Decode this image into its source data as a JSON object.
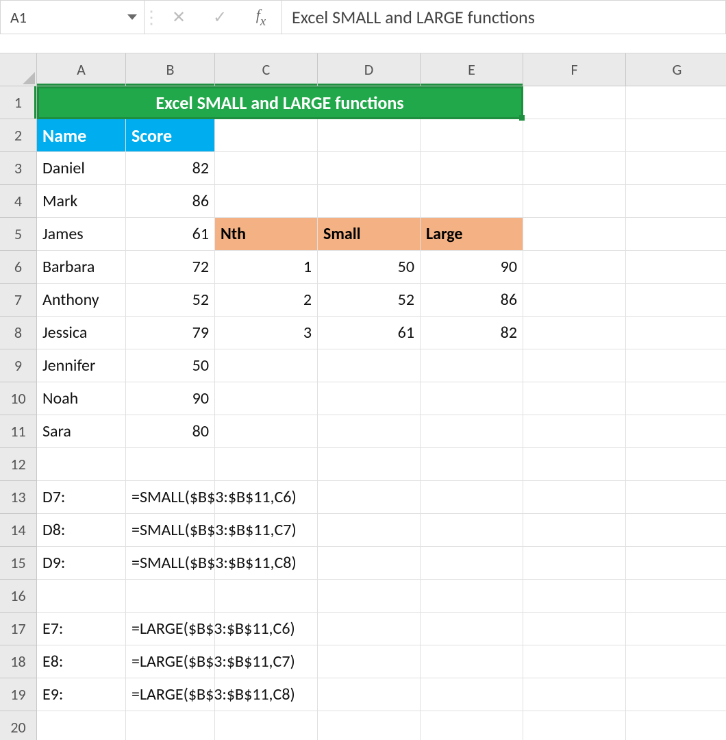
{
  "toolbar": {
    "name_box": "A1",
    "formula_text": "Excel SMALL and LARGE functions",
    "fx_label": "fx"
  },
  "columns": [
    "A",
    "B",
    "C",
    "D",
    "E",
    "F",
    "G"
  ],
  "row_count": 20,
  "title_cell": "Excel SMALL and LARGE functions",
  "name_header": "Name",
  "score_header": "Score",
  "records": [
    {
      "name": "Daniel",
      "score": 82
    },
    {
      "name": "Mark",
      "score": 86
    },
    {
      "name": "James",
      "score": 61
    },
    {
      "name": "Barbara",
      "score": 72
    },
    {
      "name": "Anthony",
      "score": 52
    },
    {
      "name": "Jessica",
      "score": 79
    },
    {
      "name": "Jennifer",
      "score": 50
    },
    {
      "name": "Noah",
      "score": 90
    },
    {
      "name": "Sara",
      "score": 80
    }
  ],
  "nth_table": {
    "headers": {
      "nth": "Nth",
      "small": "Small",
      "large": "Large"
    },
    "rows": [
      {
        "n": 1,
        "small": 50,
        "large": 90
      },
      {
        "n": 2,
        "small": 52,
        "large": 86
      },
      {
        "n": 3,
        "small": 61,
        "large": 82
      }
    ]
  },
  "formula_labels": {
    "d7": "D7:",
    "d8": "D8:",
    "d9": "D9:",
    "e7": "E7:",
    "e8": "E8:",
    "e9": "E9:"
  },
  "formulas": {
    "d7": "=SMALL($B$3:$B$11,C6)",
    "d8": "=SMALL($B$3:$B$11,C7)",
    "d9": "=SMALL($B$3:$B$11,C8)",
    "e7": "=LARGE($B$3:$B$11,C6)",
    "e8": "=LARGE($B$3:$B$11,C7)",
    "e9": "=LARGE($B$3:$B$11,C8)"
  },
  "selection": {
    "top_row": 1,
    "span_cols": 5,
    "height_rows": 1
  }
}
